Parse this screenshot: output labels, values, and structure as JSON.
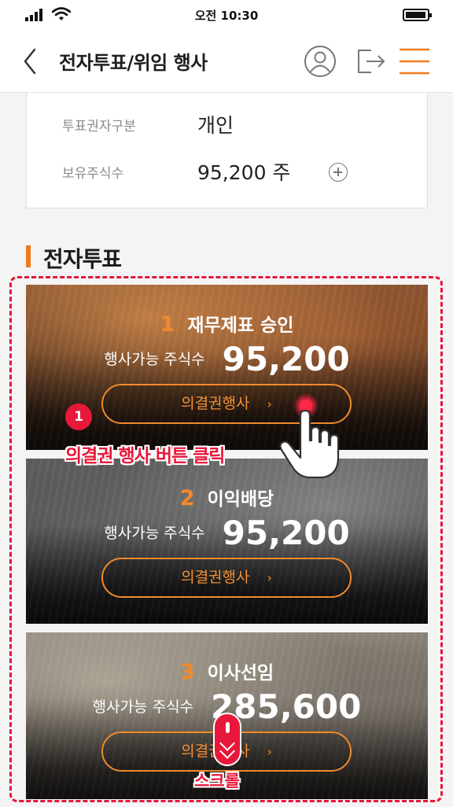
{
  "status_bar": {
    "time": "오전 10:30"
  },
  "header": {
    "title": "전자투표/위임 행사"
  },
  "icons": {
    "back": "back-arrow-icon",
    "profile": "user-profile-icon",
    "logout": "logout-icon",
    "menu": "hamburger-menu-icon",
    "add": "plus-circle-icon",
    "hand": "tap-hand-icon",
    "scroll": "scroll-mouse-icon"
  },
  "info": {
    "rows": [
      {
        "label": "투표권자구분",
        "value": "개인"
      },
      {
        "label": "보유주식수",
        "value": "95,200 주"
      }
    ]
  },
  "section": {
    "title": "전자투표"
  },
  "votes": [
    {
      "number": "1",
      "title": "재무제표 승인",
      "shares_label": "행사가능 주식수",
      "shares_value": "95,200",
      "button_label": "의결권행사",
      "chevron": "›"
    },
    {
      "number": "2",
      "title": "이익배당",
      "shares_label": "행사가능 주식수",
      "shares_value": "95,200",
      "button_label": "의결권행사",
      "chevron": "›"
    },
    {
      "number": "3",
      "title": "이사선임",
      "shares_label": "행사가능 주식수",
      "shares_value": "285,600",
      "button_label": "의결권행사",
      "chevron": "›"
    }
  ],
  "annotations": {
    "step_number": "1",
    "click_instruction": "의결권 행사 버튼 클릭",
    "scroll_instruction": "스크롤"
  },
  "colors": {
    "accent": "#f07b1e",
    "annotation": "#e8183b"
  }
}
